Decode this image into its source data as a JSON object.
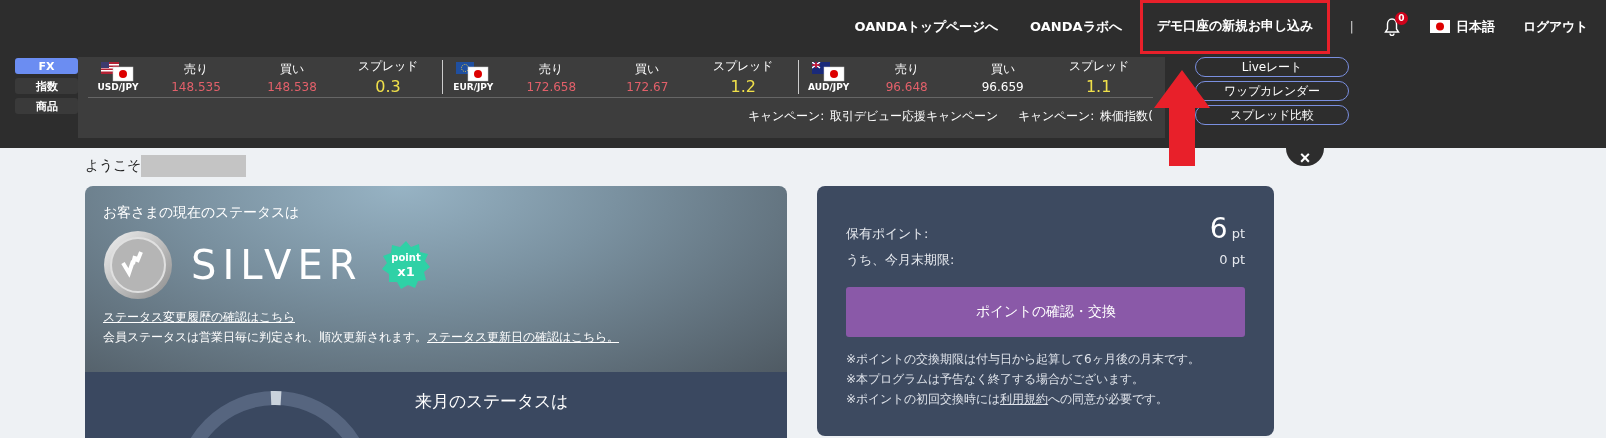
{
  "top_nav": {
    "links": [
      {
        "label": "OANDAトップページへ",
        "highlighted": false
      },
      {
        "label": "OANDAラボへ",
        "highlighted": false
      },
      {
        "label": "デモ口座の新規お申し込み",
        "highlighted": true
      }
    ],
    "separator": "|",
    "notification_count": "0",
    "language": "日本語",
    "logout": "ログアウト"
  },
  "market_tabs": [
    {
      "label": "FX",
      "selected": true
    },
    {
      "label": "指数",
      "selected": false
    },
    {
      "label": "商品",
      "selected": false
    }
  ],
  "rates": [
    {
      "pair": "USD/JPY",
      "sell_label": "売り",
      "sell": "148.535",
      "buy_label": "買い",
      "buy": "148.538",
      "color": "#e2606a",
      "spread_label": "スプレッド",
      "spread": "0.3"
    },
    {
      "pair": "EUR/JPY",
      "sell_label": "売り",
      "sell": "172.658",
      "buy_label": "買い",
      "buy": "172.67",
      "color": "#e2606a",
      "spread_label": "スプレッド",
      "spread": "1.2"
    },
    {
      "pair": "AUD/JPY",
      "sell_label": "売り",
      "sell": "96.648",
      "buy_label": "買い",
      "buy": "96.659",
      "color": "#ffffff",
      "spread_label": "スプレッド",
      "spread": "1.1"
    }
  ],
  "campaigns": [
    {
      "label": "キャンペーン:",
      "name": "取引デビュー応援キャンペーン"
    },
    {
      "label": "キャンペーン:",
      "name": "株価指数("
    }
  ],
  "side_buttons": [
    "Liveレート",
    "ワップカレンダー",
    "スプレッド比較"
  ],
  "close": "×",
  "welcome": "ようこそ",
  "status_card": {
    "heading": "お客さまの現在のステータスは",
    "rank": "SILVER",
    "badge_top": "point",
    "badge_bottom": "x1",
    "history_link": "ステータス変更履歴の確認はこちら",
    "note": "会員ステータスは営業日毎に判定され、順次更新されます。",
    "note_link": "ステータス更新日の確認はこちら。",
    "next_heading": "来月のステータスは"
  },
  "points_card": {
    "held_label": "保有ポイント:",
    "held_value": "6",
    "held_unit": "pt",
    "expiring_label": "うち、今月末期限:",
    "expiring_value": "0 pt",
    "button": "ポイントの確認・交換",
    "notes": [
      "※ポイントの交換期限は付与日から起算して6ヶ月後の月末です。",
      "※本プログラムは予告なく終了する場合がございます。"
    ],
    "terms_note": {
      "before": "※ポイントの初回交換時には",
      "link": "利用規約",
      "after": "への同意が必要です。"
    }
  }
}
